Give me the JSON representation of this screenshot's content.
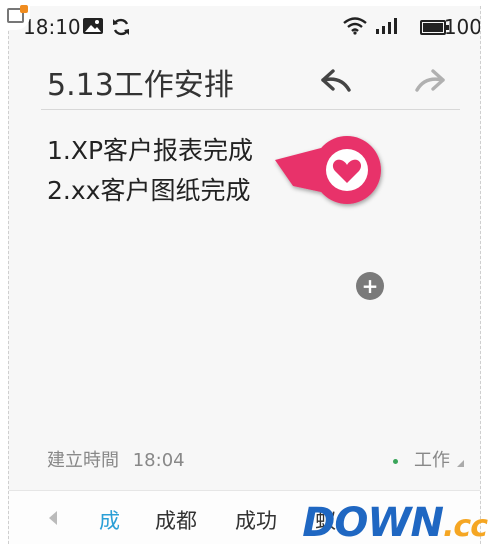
{
  "status_bar": {
    "time": "18:10",
    "battery_percent": "100",
    "icons": [
      "image-icon",
      "sync-icon",
      "wifi-icon",
      "signal-icon",
      "battery-icon"
    ]
  },
  "note": {
    "title": "5.13工作安排",
    "lines": [
      "1.XP客户报表完成",
      "2.xx客户图纸完成"
    ],
    "created_label": "建立時間",
    "created_time": "18:04",
    "category": "工作"
  },
  "header": {
    "undo_icon": "undo-arrow-icon",
    "redo_icon": "redo-arrow-icon"
  },
  "suggestions": [
    "成",
    "成都",
    "成功",
    "蚁"
  ],
  "colors": {
    "heart_bubble": "#e8336a",
    "suggestion_active": "#2a9fd6",
    "category_dot": "#3aa55a"
  },
  "watermark": {
    "left": "DOWN",
    "right": ".cc"
  }
}
